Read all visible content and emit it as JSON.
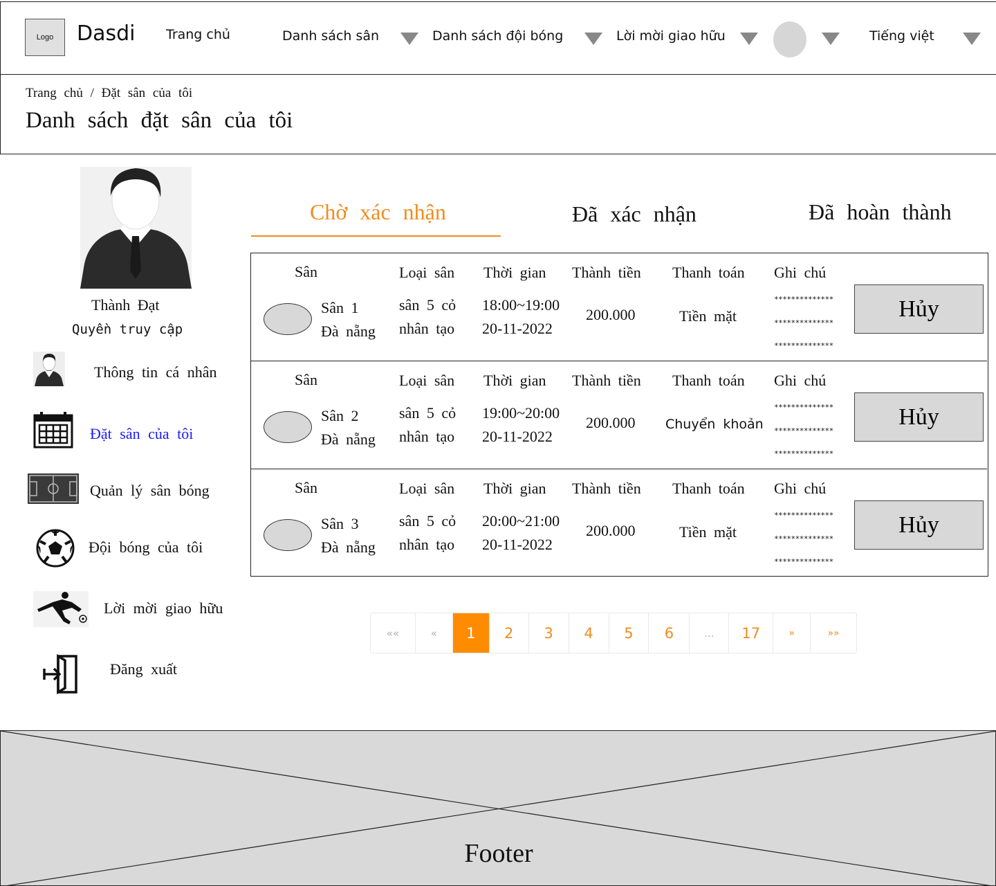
{
  "navbar": {
    "logo": "Logo",
    "brand": "Dasdi",
    "home": "Trang chủ",
    "fields": "Danh sách sân",
    "teams": "Danh sách đội bóng",
    "invites": "Lời mời giao hữu",
    "language": "Tiếng việt"
  },
  "breadcrumb": {
    "home": "Trang chủ",
    "sep": "/",
    "current": "Đặt sân của tôi"
  },
  "page_title": "Danh sách đặt sân của tôi",
  "user": {
    "name": "Thành Đạt",
    "role": "Quyền truy cập"
  },
  "sidebar": {
    "profile": "Thông tin cá nhân",
    "my_bookings": "Đặt sân của tôi",
    "manage_fields": "Quản lý sân bóng",
    "my_team": "Đội bóng của tôi",
    "invites": "Lời mời giao hữu",
    "logout": "Đăng xuất"
  },
  "tabs": {
    "pending": "Chờ xác nhận",
    "confirmed": "Đã xác nhận",
    "completed": "Đã hoàn thành"
  },
  "headers": {
    "field": "Sân",
    "type": "Loại sân",
    "time": "Thời gian",
    "total": "Thành tiền",
    "payment": "Thanh toán",
    "note": "Ghi chú"
  },
  "rows": [
    {
      "name": "Sân 1",
      "city": "Đà nẵng",
      "type1": "sân 5 cỏ",
      "type2": "nhân tạo",
      "time": "18:00~19:00",
      "date": "20-11-2022",
      "total": "200.000",
      "payment": "Tiền mặt",
      "note": "**************",
      "action": "Hủy"
    },
    {
      "name": "Sân 2",
      "city": "Đà nẵng",
      "type1": "sân 5 cỏ",
      "type2": "nhân tạo",
      "time": "19:00~20:00",
      "date": "20-11-2022",
      "total": "200.000",
      "payment": "Chuyển khoản",
      "note": "**************",
      "action": "Hủy"
    },
    {
      "name": "Sân 3",
      "city": "Đà nẵng",
      "type1": "sân 5 cỏ",
      "type2": "nhân tạo",
      "time": "20:00~21:00",
      "date": "20-11-2022",
      "total": "200.000",
      "payment": "Tiền mặt",
      "note": "**************",
      "action": "Hủy"
    }
  ],
  "pagination": {
    "first": "««",
    "prev": "«",
    "pages": [
      "1",
      "2",
      "3",
      "4",
      "5",
      "6",
      "...",
      "17"
    ],
    "next": "»",
    "last": "»»",
    "current": "1"
  },
  "footer": "Footer",
  "colors": {
    "accent": "#f08c1e",
    "active_page": "#ff8c00",
    "active_link": "#1a1aff",
    "placeholder_gray": "#d9d9d9"
  }
}
